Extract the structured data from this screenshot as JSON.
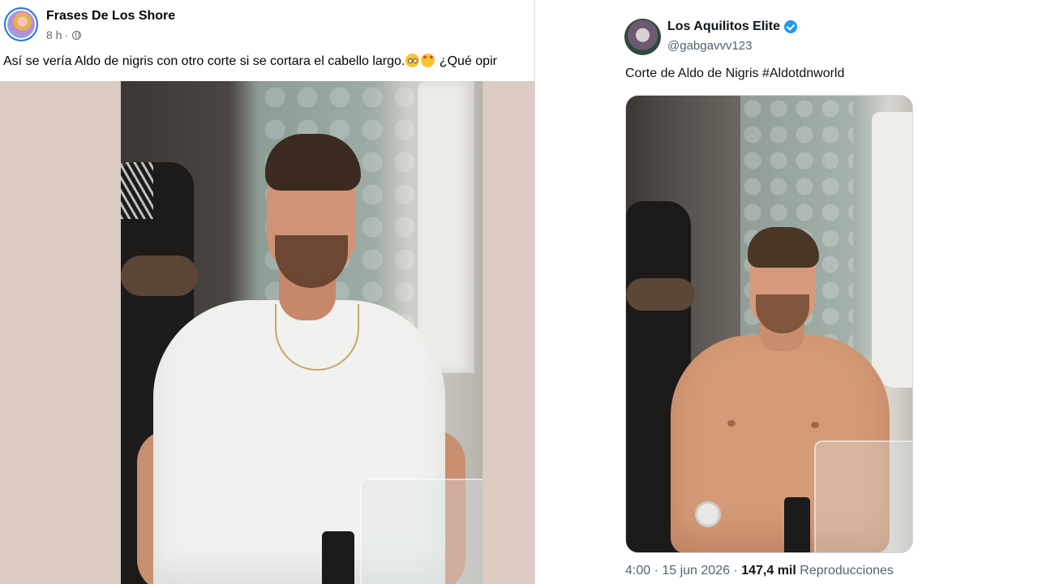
{
  "facebook_post": {
    "author": "Frases De Los Shore",
    "time": "8 h",
    "separator": "·",
    "visibility_icon": "globe-icon",
    "text_before_emoji": "Así se vería Aldo de nigris con otro corte si se cortara el cabello largo.",
    "emojis": [
      "flushed-face-emoji",
      "star-struck-emoji"
    ],
    "text_after_emoji": " ¿Qué opir",
    "image": "photo-man-white-tshirt-barbershop"
  },
  "x_post": {
    "display_name": "Los Aquilitos Elite",
    "verified_icon": "verified-badge-icon",
    "handle": "@gabgavvv123",
    "text": "Corte de Aldo de Nigris #Aldotdnworld",
    "image": "photo-man-shirtless-barbershop",
    "timestamp": "4:00 · 15 jun 2026 ·",
    "views_count": "147,4 mil",
    "views_label": "Reproducciones"
  },
  "colors": {
    "facebook_blue": "#1b74e4",
    "x_blue": "#1d9bf0",
    "text_primary": "#050505",
    "text_secondary": "#65676b",
    "x_secondary": "#536471"
  }
}
